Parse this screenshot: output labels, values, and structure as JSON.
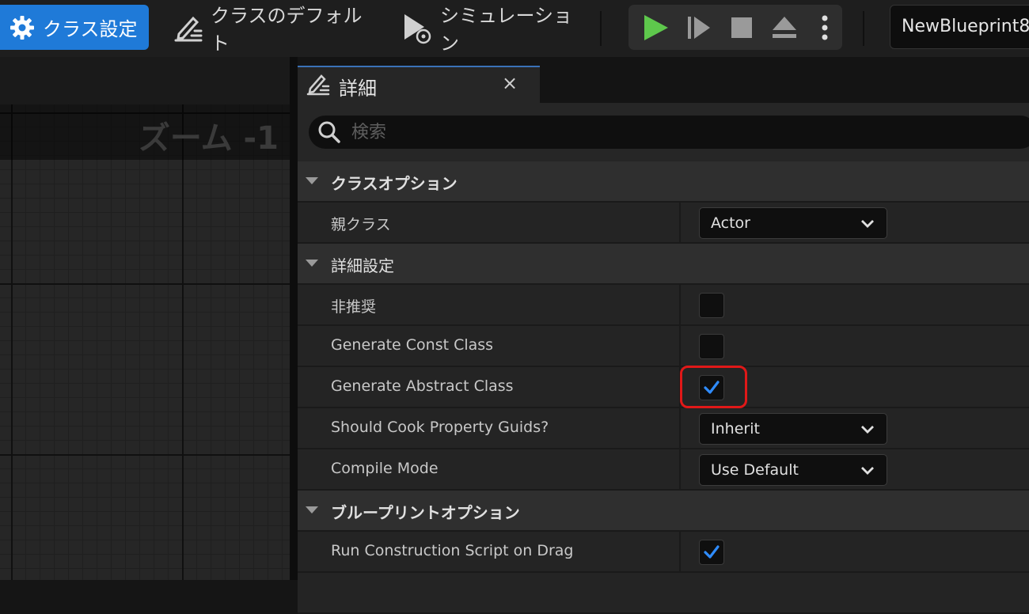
{
  "toolbar": {
    "class_settings_label": "クラス設定",
    "class_defaults_label": "クラスのデフォルト",
    "simulation_label": "シミュレーション",
    "asset_name": "NewBlueprint8"
  },
  "graph": {
    "zoom_label": "ズーム -1"
  },
  "details": {
    "tab_title": "詳細",
    "close_glyph": "×",
    "search_placeholder": "検索"
  },
  "sections": {
    "class_options": {
      "label": "クラスオプション",
      "parent_class": {
        "label": "親クラス",
        "value": "Actor"
      }
    },
    "advanced": {
      "label": "詳細設定",
      "deprecated": {
        "label": "非推奨",
        "checked": false
      },
      "generate_const_class": {
        "label": "Generate Const Class",
        "checked": false
      },
      "generate_abstract_class": {
        "label": "Generate Abstract Class",
        "checked": true
      },
      "should_cook_property_guids": {
        "label": "Should Cook Property Guids?",
        "value": "Inherit"
      },
      "compile_mode": {
        "label": "Compile Mode",
        "value": "Use Default"
      }
    },
    "blueprint_options": {
      "label": "ブループリントオプション",
      "run_construction_script_on_drag": {
        "label": "Run Construction Script on Drag",
        "checked": true
      }
    }
  },
  "colors": {
    "accent": "#1f7ad8",
    "play_green": "#5ec84c",
    "highlight_red": "#e01818",
    "check_blue": "#2f8cff"
  }
}
